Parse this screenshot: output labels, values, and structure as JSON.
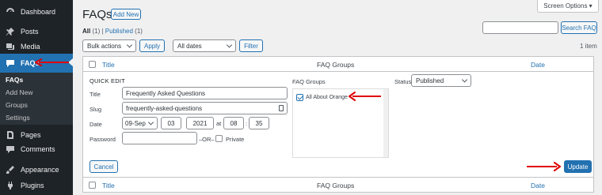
{
  "sidebar": {
    "items": [
      {
        "label": "Dashboard",
        "icon": "dashboard-icon"
      },
      {
        "label": "Posts",
        "icon": "pin-icon"
      },
      {
        "label": "Media",
        "icon": "media-icon"
      },
      {
        "label": "FAQs",
        "icon": "faq-icon"
      },
      {
        "label": "Pages",
        "icon": "pages-icon"
      },
      {
        "label": "Comments",
        "icon": "comments-icon"
      },
      {
        "label": "Appearance",
        "icon": "appearance-icon"
      },
      {
        "label": "Plugins",
        "icon": "plugins-icon"
      }
    ],
    "submenu": [
      "FAQs",
      "Add New",
      "Groups",
      "Settings"
    ]
  },
  "header": {
    "title": "FAQs",
    "add_new": "Add New",
    "screen_options": "Screen Options ▾"
  },
  "filters": {
    "all": "All",
    "all_count": "(1)",
    "separator": "|",
    "published": "Published",
    "published_count": "(1)",
    "bulk_actions": "Bulk actions",
    "apply": "Apply",
    "all_dates": "All dates",
    "filter": "Filter",
    "search_button": "Search FAQ",
    "items_count": "1 item"
  },
  "table": {
    "columns": {
      "title": "Title",
      "groups": "FAQ Groups",
      "date": "Date"
    }
  },
  "quick_edit": {
    "heading": "QUICK EDIT",
    "title_label": "Title",
    "title_value": "Frequently Asked Questions",
    "slug_label": "Slug",
    "slug_value": "frequently-asked-questions",
    "date_label": "Date",
    "month": "09-Sep",
    "day": "03",
    "year": "2021",
    "at": "at",
    "hour": "08",
    "colon": ":",
    "minute": "35",
    "password_label": "Password",
    "or": "–OR–",
    "private_label": "Private",
    "groups_label": "FAQ Groups",
    "group_option": "All About Orange",
    "status_label": "Status",
    "status_value": "Published",
    "cancel": "Cancel",
    "update": "Update"
  },
  "colors": {
    "accent": "#2271b1",
    "annotation": "#e00000",
    "sidebar": "#1d2327"
  }
}
